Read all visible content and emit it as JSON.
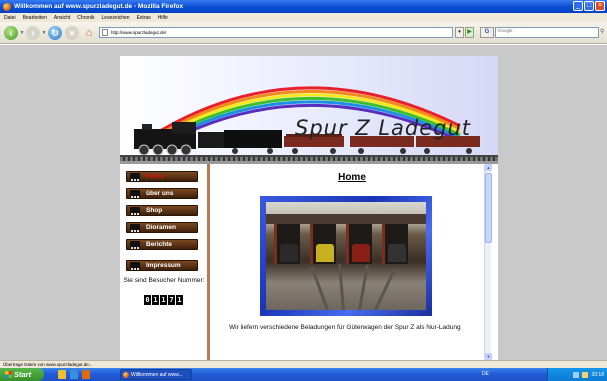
{
  "window": {
    "title": "Willkommen auf www.spurzladegut.de - Mozilla Firefox",
    "controls": [
      "_",
      "□",
      "×"
    ]
  },
  "menubar": [
    "Datei",
    "Bearbeiten",
    "Ansicht",
    "Chronik",
    "Lesezeichen",
    "Extras",
    "Hilfe"
  ],
  "toolbar": {
    "url": "http://www.spurzladegut.de/",
    "search_engine": "G",
    "search_placeholder": "Google"
  },
  "site": {
    "banner_title": "Spur Z   Ladegut",
    "nav": [
      {
        "label": "Home",
        "active": true
      },
      {
        "label": "über uns",
        "active": false
      },
      {
        "label": "Shop",
        "active": false
      },
      {
        "label": "Dioramen",
        "active": false
      },
      {
        "label": "Berichte",
        "active": false
      },
      {
        "label": "Impressum",
        "active": false
      }
    ],
    "visitor_label": "Sie sind Besucher Nummer:",
    "counter_digits": [
      "0",
      "1",
      "1",
      "7",
      "1"
    ],
    "page_heading": "Home",
    "description": "Wir liefern verschiedene Beladungen für Güterwagen der Spur Z als Nur-Ladung"
  },
  "statusbar": {
    "text": "Übertrage Daten von www.spurzladegut.de..."
  },
  "taskbar": {
    "start_label": "Start",
    "task_item": "Willkommen auf www...",
    "language": "DE",
    "clock": "20:18"
  }
}
